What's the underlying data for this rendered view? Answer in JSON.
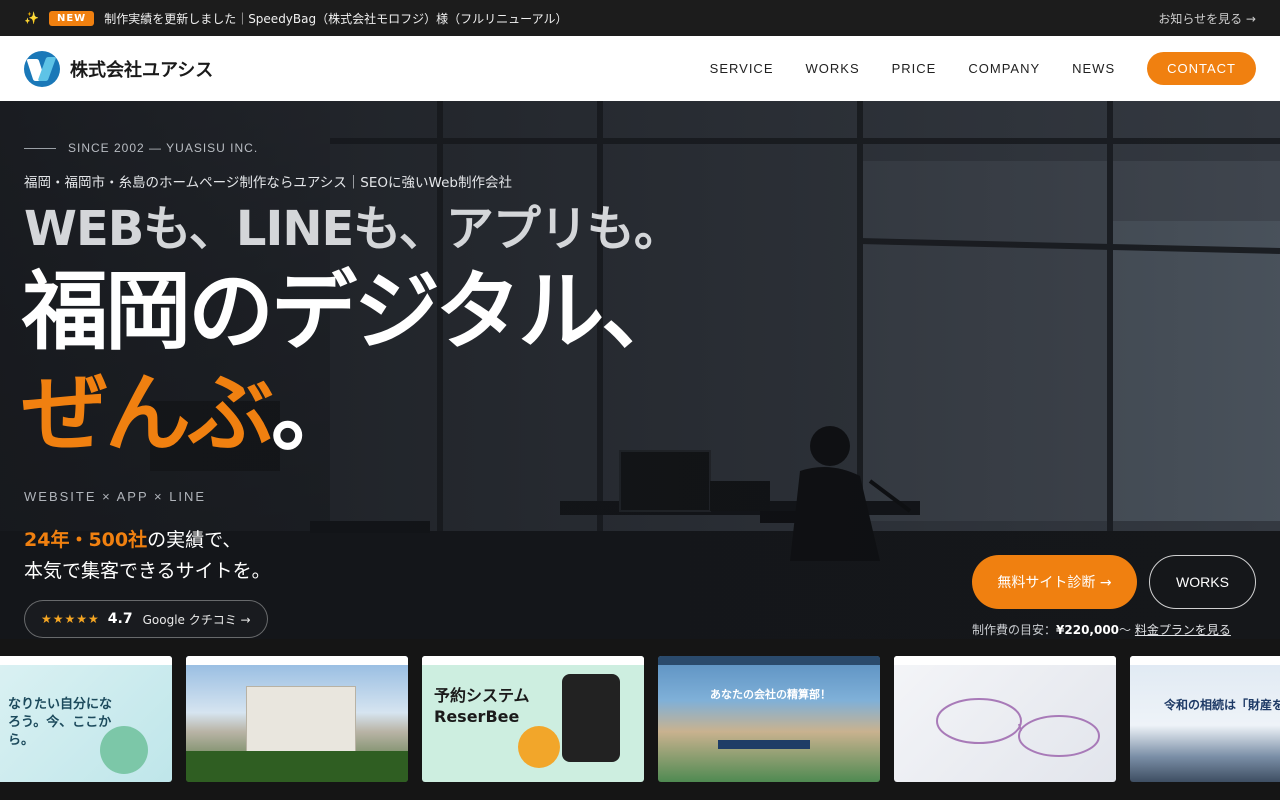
{
  "topbar": {
    "badge": "NEW",
    "news_text": "制作実績を更新しました｜SpeedyBag（株式会社モロフジ）様（フルリニューアル）",
    "all_news": "お知らせを見る →"
  },
  "header": {
    "logo_text": "株式会社ユアシス",
    "nav": [
      "SERVICE",
      "WORKS",
      "PRICE",
      "COMPANY",
      "NEWS"
    ],
    "contact": "CONTACT"
  },
  "hero": {
    "since": "SINCE 2002 — YUASISU INC.",
    "subtitle": "福岡・福岡市・糸島のホームページ制作ならユアシス｜SEOに強いWeb制作会社",
    "headline_1": "WEBも、LINEも、アプリも。",
    "headline_2": "福岡のデジタル、",
    "headline_3": "ぜんぶ",
    "headline_3_dot": "。",
    "tags": "WEBSITE × APP × LINE",
    "lead_highlight": "24年・500社",
    "lead_rest": "の実績で、",
    "lead_line_2": "本気で集客できるサイトを。",
    "rating_stars": "★★★★★",
    "rating_score": "4.7",
    "rating_label": "Google クチコミ →",
    "cta_primary": "無料サイト診断 →",
    "cta_secondary": "WORKS",
    "price_label": "制作費の目安：",
    "price_value": "¥220,000",
    "price_suffix": "〜",
    "price_link": "料金プランを見る"
  },
  "works": [
    {
      "label": "なりたい自分になろう。今、ここから。"
    },
    {
      "label": ""
    },
    {
      "label": "予約システム ReserBee"
    },
    {
      "label": "あなたの会社の精算部！"
    },
    {
      "label": ""
    },
    {
      "label": "令和の相続は「財産を残す」"
    }
  ],
  "colors": {
    "accent": "#f08010",
    "header_bg": "#ffffff",
    "topbar_bg": "#1c1c1c"
  }
}
